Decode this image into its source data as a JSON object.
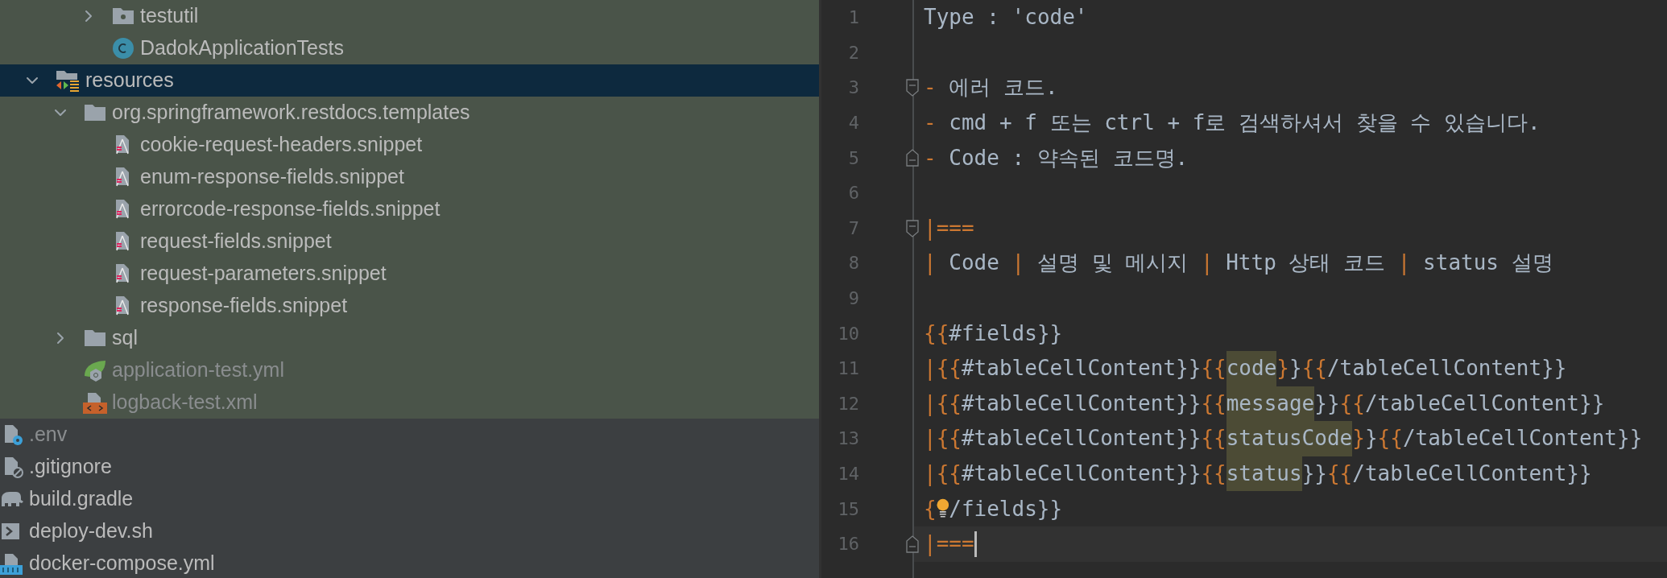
{
  "project_tree": {
    "partial_items": [
      {
        "name": "testutil",
        "kind": "package",
        "expanded": false,
        "selected": false,
        "ignored": false
      },
      {
        "name": "DadokApplicationTests",
        "kind": "class",
        "selected": false,
        "ignored": false
      }
    ],
    "items": [
      {
        "name": "resources",
        "kind": "resources",
        "expanded": true,
        "selected": true,
        "ignored": false,
        "children": [
          {
            "name": "org.springframework.restdocs.templates",
            "kind": "folder",
            "expanded": true,
            "selected": false,
            "ignored": false,
            "children": [
              {
                "name": "cookie-request-headers.snippet",
                "kind": "snippet",
                "selected": false,
                "ignored": false
              },
              {
                "name": "enum-response-fields.snippet",
                "kind": "snippet",
                "selected": false,
                "ignored": false
              },
              {
                "name": "errorcode-response-fields.snippet",
                "kind": "snippet",
                "selected": false,
                "ignored": false
              },
              {
                "name": "request-fields.snippet",
                "kind": "snippet",
                "selected": false,
                "ignored": false
              },
              {
                "name": "request-parameters.snippet",
                "kind": "snippet",
                "selected": false,
                "ignored": false
              },
              {
                "name": "response-fields.snippet",
                "kind": "snippet",
                "selected": false,
                "ignored": false
              }
            ]
          },
          {
            "name": "sql",
            "kind": "folder",
            "expanded": false,
            "selected": false,
            "ignored": false
          },
          {
            "name": "application-test.yml",
            "kind": "spring",
            "selected": false,
            "ignored": true
          },
          {
            "name": "logback-test.xml",
            "kind": "xml",
            "selected": false,
            "ignored": true
          }
        ]
      }
    ]
  },
  "root_files": [
    {
      "name": ".env",
      "kind": "env",
      "selected": false,
      "ignored": true
    },
    {
      "name": ".gitignore",
      "kind": "gitignore",
      "selected": false,
      "ignored": false
    },
    {
      "name": "build.gradle",
      "kind": "gradle",
      "selected": false,
      "ignored": false
    },
    {
      "name": "deploy-dev.sh",
      "kind": "shell",
      "selected": false,
      "ignored": false
    },
    {
      "name": "docker-compose.yml",
      "kind": "docker",
      "selected": false,
      "ignored": false
    }
  ],
  "editor": {
    "lines": [
      {
        "number": "1",
        "kind": "plain",
        "current": false,
        "tokens": [
          {
            "kind": "plain",
            "text": "Type : 'code'"
          }
        ]
      },
      {
        "number": "2",
        "kind": "plain",
        "current": false
      },
      {
        "number": "3",
        "kind": "fold_start",
        "current": false,
        "tokens": [
          {
            "kind": "punct",
            "text": "- "
          },
          {
            "kind": "plain",
            "text": "에러 코드."
          }
        ]
      },
      {
        "number": "4",
        "kind": "plain",
        "current": false,
        "tokens": [
          {
            "kind": "punct",
            "text": "- "
          },
          {
            "kind": "plain",
            "text": "cmd + f 또는 ctrl + f로 검색하셔서 찾을 수 있습니다."
          }
        ]
      },
      {
        "number": "5",
        "kind": "fold_end",
        "current": false,
        "tokens": [
          {
            "kind": "punct",
            "text": "- "
          },
          {
            "kind": "plain",
            "text": "Code : 약속된 코드명."
          }
        ]
      },
      {
        "number": "6",
        "kind": "plain",
        "current": false
      },
      {
        "number": "7",
        "kind": "fold_start",
        "current": false,
        "tokens": [
          {
            "kind": "punct",
            "text": "|==="
          }
        ]
      },
      {
        "number": "8",
        "kind": "plain",
        "current": false,
        "tokens": [
          {
            "kind": "punct",
            "text": "| "
          },
          {
            "kind": "plain",
            "text": "Code "
          },
          {
            "kind": "punct",
            "text": "| "
          },
          {
            "kind": "plain",
            "text": "설명 및 메시지 "
          },
          {
            "kind": "punct",
            "text": "| "
          },
          {
            "kind": "plain",
            "text": "Http 상태 코드 "
          },
          {
            "kind": "punct",
            "text": "| "
          },
          {
            "kind": "plain",
            "text": "status 설명"
          }
        ]
      },
      {
        "number": "9",
        "kind": "plain",
        "current": false
      },
      {
        "number": "10",
        "kind": "plain",
        "current": false,
        "tokens": [
          {
            "kind": "punct",
            "text": "{{"
          },
          {
            "kind": "plain",
            "text": "#fields}}"
          }
        ]
      },
      {
        "number": "11",
        "kind": "plain",
        "current": false,
        "tokens": [
          {
            "kind": "punct",
            "text": "|{{"
          },
          {
            "kind": "plain",
            "text": "#tableCellContent}}"
          },
          {
            "kind": "punct",
            "text": "{{"
          },
          {
            "kind": "match",
            "text": "code"
          },
          {
            "kind": "punct",
            "text": "}"
          },
          {
            "kind": "plain",
            "text": "}"
          },
          {
            "kind": "punct",
            "text": "{{"
          },
          {
            "kind": "plain",
            "text": "/tableCellContent}}"
          }
        ]
      },
      {
        "number": "12",
        "kind": "plain",
        "current": false,
        "tokens": [
          {
            "kind": "punct",
            "text": "|{{"
          },
          {
            "kind": "plain",
            "text": "#tableCellContent}}"
          },
          {
            "kind": "punct",
            "text": "{{"
          },
          {
            "kind": "match",
            "text": "message"
          },
          {
            "kind": "plain",
            "text": "}}"
          },
          {
            "kind": "punct",
            "text": "{{"
          },
          {
            "kind": "plain",
            "text": "/tableCellContent}}"
          }
        ]
      },
      {
        "number": "13",
        "kind": "plain",
        "current": false,
        "tokens": [
          {
            "kind": "punct",
            "text": "|{{"
          },
          {
            "kind": "plain",
            "text": "#tableCellContent}}"
          },
          {
            "kind": "punct",
            "text": "{{"
          },
          {
            "kind": "match",
            "text": "statusCode"
          },
          {
            "kind": "punct",
            "text": "}"
          },
          {
            "kind": "plain",
            "text": "}"
          },
          {
            "kind": "punct",
            "text": "{{"
          },
          {
            "kind": "plain",
            "text": "/tableCellContent}}"
          }
        ]
      },
      {
        "number": "14",
        "kind": "plain",
        "current": false,
        "tokens": [
          {
            "kind": "punct",
            "text": "|{{"
          },
          {
            "kind": "plain",
            "text": "#tableCellContent}}"
          },
          {
            "kind": "punct",
            "text": "{{"
          },
          {
            "kind": "match",
            "text": "status"
          },
          {
            "kind": "plain",
            "text": "}}"
          },
          {
            "kind": "punct",
            "text": "{{"
          },
          {
            "kind": "plain",
            "text": "/tableCellContent}}"
          }
        ]
      },
      {
        "number": "15",
        "kind": "plain",
        "current": false,
        "tokens": [
          {
            "kind": "punct",
            "text": "{"
          },
          {
            "kind": "bulb"
          },
          {
            "kind": "plain",
            "text": "/fields}}"
          }
        ]
      },
      {
        "number": "16",
        "kind": "fold_end",
        "current": true,
        "tokens": [
          {
            "kind": "punct",
            "text": "|==="
          }
        ]
      }
    ]
  }
}
